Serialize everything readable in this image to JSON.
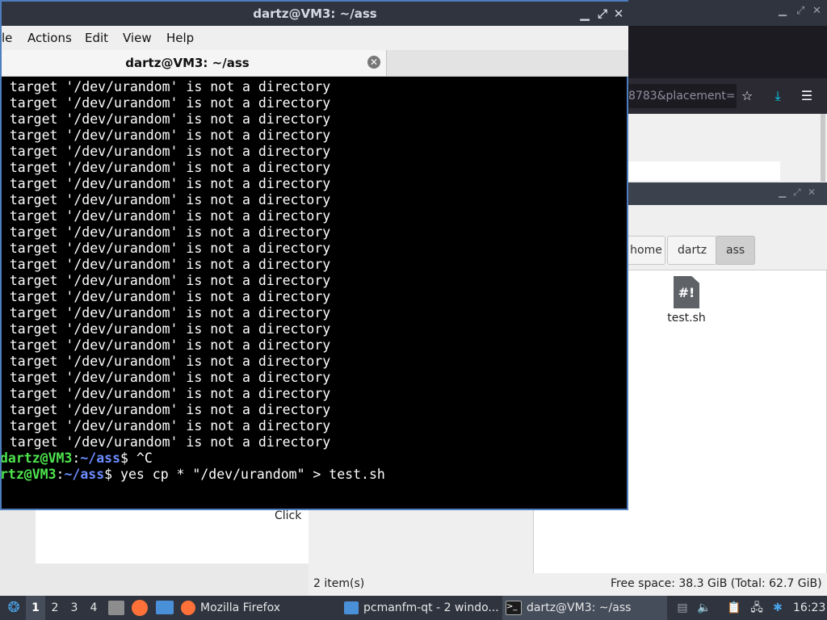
{
  "firefox": {
    "url_fragment": "8783&placement=",
    "icons": [
      "bookmark-star-icon",
      "download-icon",
      "menu-icon"
    ]
  },
  "webpage": {
    "partial_text": "Click"
  },
  "filemanager": {
    "breadcrumbs": [
      "home",
      "dartz",
      "ass"
    ],
    "files": [
      {
        "name": "test.sh",
        "icon": "#!"
      }
    ],
    "status_items": "2 item(s)",
    "status_free": "Free space: 38.3 GiB (Total: 62.7 GiB)"
  },
  "terminal": {
    "window_title": "dartz@VM3: ~/ass",
    "menu": [
      "le",
      "Actions",
      "Edit",
      "View",
      "Help"
    ],
    "tab_label": "dartz@VM3: ~/ass",
    "error_line": ": target '/dev/urandom' is not a directory",
    "error_count": 23,
    "prompt1": {
      "user": "dartz@VM3",
      "path": "~/ass",
      "text": "$ ^C"
    },
    "prompt2": {
      "user": "rtz@VM3",
      "path": "~/ass",
      "text": "$ yes cp * \"/dev/urandom\" > test.sh"
    }
  },
  "taskbar": {
    "workspaces": [
      "1",
      "2",
      "3",
      "4"
    ],
    "active_workspace": "1",
    "tasks": [
      {
        "label": "Mozilla Firefox",
        "icon": "firefox-icon"
      },
      {
        "label": "pcmanfm-qt - 2 windo...",
        "icon": "folder-icon"
      },
      {
        "label": "dartz@VM3: ~/ass",
        "icon": "terminal-icon"
      }
    ],
    "clock": "16:23"
  },
  "colors": {
    "titlebar": "#2f343f",
    "terminal_bg": "#000000",
    "prompt_user": "#4ee44e",
    "prompt_path": "#6c8cff",
    "active_border": "#4d7dbd"
  }
}
